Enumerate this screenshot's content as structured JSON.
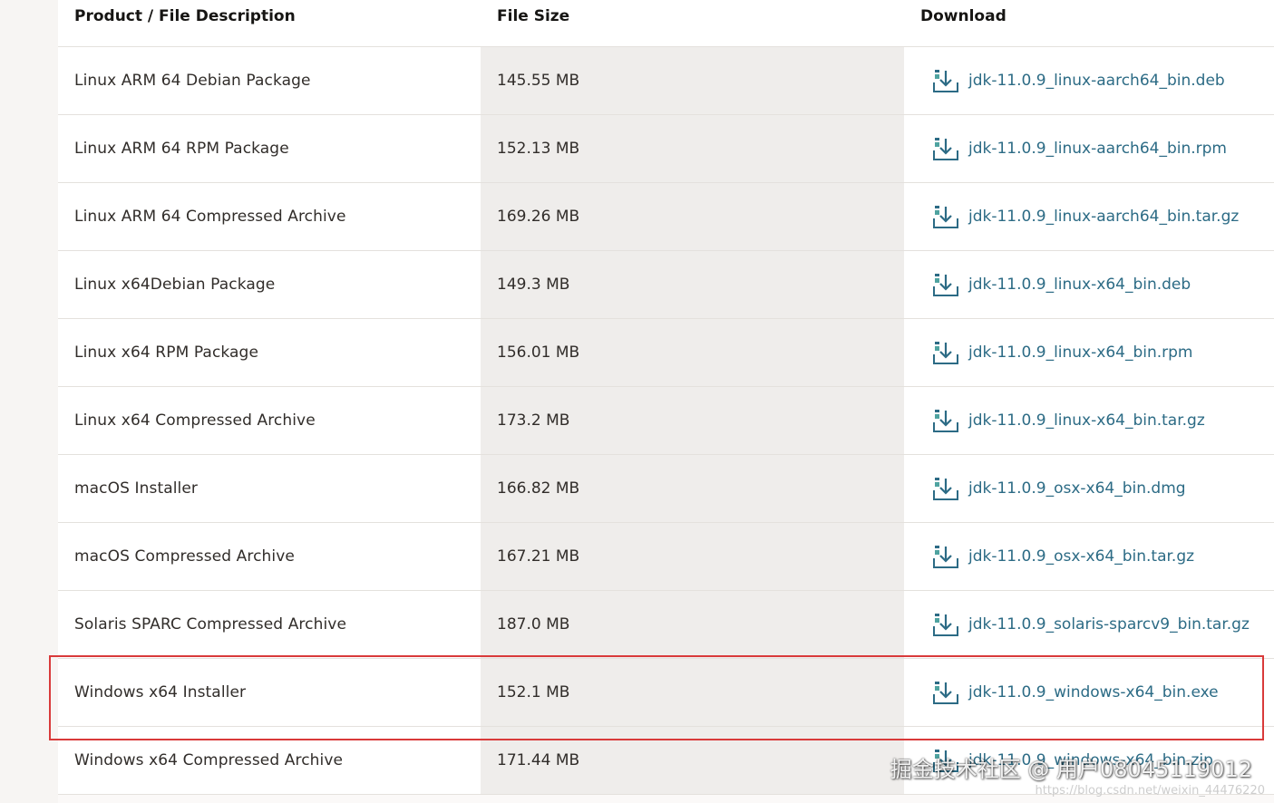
{
  "table": {
    "headers": {
      "description": "Product / File Description",
      "size": "File Size",
      "download": "Download"
    },
    "rows": [
      {
        "description": "Linux ARM 64 Debian Package",
        "size": "145.55 MB",
        "file": "jdk-11.0.9_linux-aarch64_bin.deb"
      },
      {
        "description": "Linux ARM 64 RPM Package",
        "size": "152.13 MB",
        "file": "jdk-11.0.9_linux-aarch64_bin.rpm"
      },
      {
        "description": "Linux ARM 64 Compressed Archive",
        "size": "169.26 MB",
        "file": "jdk-11.0.9_linux-aarch64_bin.tar.gz"
      },
      {
        "description": "Linux x64Debian Package",
        "size": "149.3 MB",
        "file": "jdk-11.0.9_linux-x64_bin.deb"
      },
      {
        "description": "Linux x64 RPM Package",
        "size": "156.01 MB",
        "file": "jdk-11.0.9_linux-x64_bin.rpm"
      },
      {
        "description": "Linux x64 Compressed Archive",
        "size": "173.2 MB",
        "file": "jdk-11.0.9_linux-x64_bin.tar.gz"
      },
      {
        "description": "macOS Installer",
        "size": "166.82 MB",
        "file": "jdk-11.0.9_osx-x64_bin.dmg"
      },
      {
        "description": "macOS Compressed Archive",
        "size": "167.21 MB",
        "file": "jdk-11.0.9_osx-x64_bin.tar.gz"
      },
      {
        "description": "Solaris SPARC Compressed Archive",
        "size": "187.0 MB",
        "file": "jdk-11.0.9_solaris-sparcv9_bin.tar.gz"
      },
      {
        "description": "Windows x64 Installer",
        "size": "152.1 MB",
        "file": "jdk-11.0.9_windows-x64_bin.exe"
      },
      {
        "description": "Windows x64 Compressed Archive",
        "size": "171.44 MB",
        "file": "jdk-11.0.9_windows-x64_bin.zip"
      }
    ]
  },
  "watermark": {
    "text": "掘金技术社区 @ 用户08045119012",
    "url": "https://blog.csdn.net/weixin_44476220"
  },
  "colors": {
    "link": "#2c6b85",
    "highlight": "#d93a3a",
    "size_column_bg": "#efedeb"
  },
  "icons": {
    "download": "download-icon"
  }
}
